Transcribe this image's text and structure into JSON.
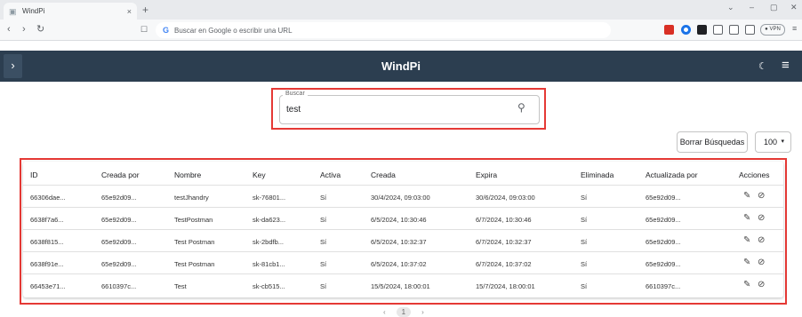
{
  "browser": {
    "tab_title": "WindPi",
    "tab_close": "×",
    "new_tab": "+",
    "window_controls": [
      "⌄",
      "–",
      "▢",
      "✕"
    ],
    "address_placeholder": "Buscar en Google o escribir una URL",
    "google_glyph": "G",
    "vpn_label": "● VPN",
    "icons": [
      "back-icon",
      "forward-icon",
      "reload-icon",
      "bookmark-icon",
      "menu-icon"
    ]
  },
  "app": {
    "title": "WindPi",
    "drawer_toggle": "›",
    "theme_icon": "☾",
    "menu_icon": "≡",
    "header_color": "#2c3e50"
  },
  "search": {
    "label": "Buscar",
    "value": "test",
    "icon": "⚲"
  },
  "controls": {
    "clear_label": "Borrar Búsquedas",
    "page_size": "100",
    "page_size_caret": "▾"
  },
  "table": {
    "headers": [
      "ID",
      "Creada por",
      "Nombre",
      "Key",
      "Activa",
      "Creada",
      "Expira",
      "Eliminada",
      "Actualizada por",
      "Acciones"
    ],
    "rows": [
      [
        "66306dae...",
        "65e92d09...",
        "testJhandry",
        "sk-76801...",
        "Sí",
        "30/4/2024, 09:03:00",
        "30/6/2024, 09:03:00",
        "Sí",
        "65e92d09..."
      ],
      [
        "6638f7a6...",
        "65e92d09...",
        "TestPostman",
        "sk-da623...",
        "Sí",
        "6/5/2024, 10:30:46",
        "6/7/2024, 10:30:46",
        "Sí",
        "65e92d09..."
      ],
      [
        "6638f815...",
        "65e92d09...",
        "Test Postman",
        "sk-2bdfb...",
        "Sí",
        "6/5/2024, 10:32:37",
        "6/7/2024, 10:32:37",
        "Sí",
        "65e92d09..."
      ],
      [
        "6638f91e...",
        "65e92d09...",
        "Test Postman",
        "sk-81cb1...",
        "Sí",
        "6/5/2024, 10:37:02",
        "6/7/2024, 10:37:02",
        "Sí",
        "65e92d09..."
      ],
      [
        "66453e71...",
        "6610397c...",
        "Test",
        "sk-cb515...",
        "Sí",
        "15/5/2024, 18:00:01",
        "15/7/2024, 18:00:01",
        "Sí",
        "6610397c..."
      ]
    ],
    "edit_icon": "✎",
    "delete_icon": "⊘"
  },
  "pagination": {
    "prev": "‹",
    "current": "1",
    "next": "›"
  },
  "colors": {
    "highlight": "#e53935"
  }
}
